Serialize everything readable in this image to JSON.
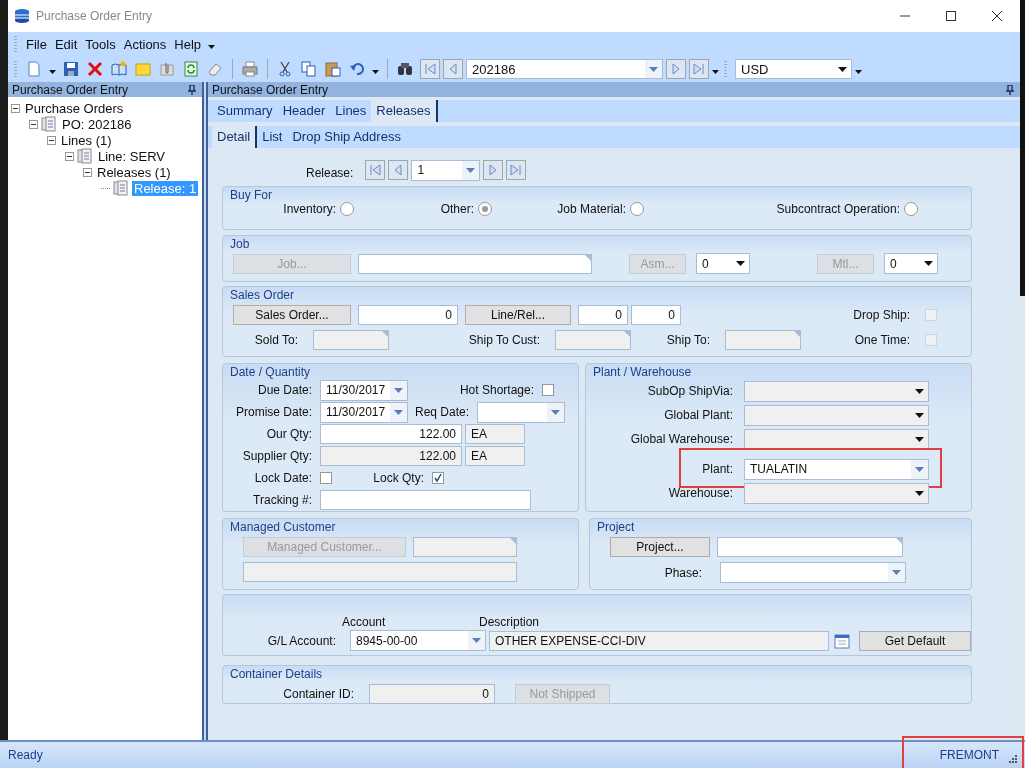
{
  "window": {
    "title": "Purchase Order Entry"
  },
  "menu": [
    {
      "label": "File"
    },
    {
      "label": "Edit"
    },
    {
      "label": "Tools"
    },
    {
      "label": "Actions"
    },
    {
      "label": "Help"
    }
  ],
  "toolbar": {
    "po_number": "202186",
    "currency": "USD"
  },
  "tree_panel": {
    "title": "Purchase Order Entry",
    "items": [
      {
        "label": "Purchase Orders",
        "icon": false,
        "expanded": true,
        "selected": false,
        "children": [
          {
            "label": "PO: 202186",
            "icon": true,
            "expanded": true,
            "selected": false,
            "children": [
              {
                "label": "Lines (1)",
                "icon": false,
                "expanded": true,
                "selected": false,
                "children": [
                  {
                    "label": "Line: SERV",
                    "icon": true,
                    "expanded": true,
                    "selected": false,
                    "children": [
                      {
                        "label": "Releases (1)",
                        "icon": false,
                        "expanded": true,
                        "selected": false,
                        "children": [
                          {
                            "label": "Release: 1",
                            "icon": true,
                            "selected": true
                          }
                        ]
                      }
                    ]
                  }
                ]
              }
            ]
          }
        ]
      }
    ]
  },
  "form_panel": {
    "title": "Purchase Order Entry",
    "tabs": [
      {
        "label": "Summary",
        "selected": false
      },
      {
        "label": "Header",
        "selected": false
      },
      {
        "label": "Lines",
        "selected": false
      },
      {
        "label": "Releases",
        "selected": true
      }
    ],
    "subtabs": [
      {
        "label": "Detail",
        "selected": true
      },
      {
        "label": "List",
        "selected": false
      },
      {
        "label": "Drop Ship Address",
        "selected": false
      }
    ]
  },
  "release": {
    "label": "Release:",
    "value": "1"
  },
  "buy_for": {
    "title": "Buy For",
    "options": [
      {
        "label": "Inventory:",
        "selected": false
      },
      {
        "label": "Other:",
        "selected": true
      },
      {
        "label": "Job Material:",
        "selected": false
      },
      {
        "label": "Subcontract Operation:",
        "selected": false
      }
    ]
  },
  "job": {
    "title": "Job",
    "job_button": {
      "label": "Job...",
      "disabled": true
    },
    "asm_button": {
      "label": "Asm...",
      "disabled": true
    },
    "asm_value": "0",
    "mtl_button": {
      "label": "Mtl...",
      "disabled": true
    },
    "mtl_value": "0"
  },
  "sales_order": {
    "title": "Sales Order",
    "order_button": {
      "label": "Sales Order...",
      "disabled": false
    },
    "order_value": "0",
    "line_button": {
      "label": "Line/Rel...",
      "disabled": false
    },
    "line_value": "0",
    "release_value": "0",
    "drop_ship": {
      "label": "Drop Ship:",
      "checked": false
    },
    "sold_to_label": "Sold To:",
    "ship_to_cust_label": "Ship To Cust:",
    "ship_to_label": "Ship To:",
    "one_time": {
      "label": "One Time:",
      "checked": false
    }
  },
  "date_quantity": {
    "title": "Date / Quantity",
    "due_date": {
      "label": "Due Date:",
      "value": "11/30/2017"
    },
    "promise_date": {
      "label": "Promise Date:",
      "value": "11/30/2017"
    },
    "hot_shortage": {
      "label": "Hot Shortage:",
      "checked": false
    },
    "req_date": {
      "label": "Req Date:"
    },
    "our_qty": {
      "label": "Our Qty:",
      "value": "122.00",
      "uom": "EA"
    },
    "supplier_qty": {
      "label": "Supplier Qty:",
      "value": "122.00",
      "uom": "EA"
    },
    "lock_date": {
      "label": "Lock Date:",
      "checked": false
    },
    "lock_qty": {
      "label": "Lock Qty:",
      "checked": true
    },
    "tracking": {
      "label": "Tracking #:"
    }
  },
  "plant_warehouse": {
    "title": "Plant / Warehouse",
    "fields": [
      {
        "label": "SubOp ShipVia:",
        "disabled": true,
        "highlighted": false
      },
      {
        "label": "Global Plant:",
        "disabled": true,
        "highlighted": false
      },
      {
        "label": "Global Warehouse:",
        "disabled": true,
        "highlighted": false
      },
      {
        "label": "Plant:",
        "value": "TUALATIN",
        "disabled": false,
        "highlighted": true
      },
      {
        "label": "Warehouse:",
        "disabled": true,
        "highlighted": false
      }
    ]
  },
  "managed_customer": {
    "title": "Managed Customer",
    "button": {
      "label": "Managed Customer...",
      "disabled": true
    }
  },
  "project": {
    "title": "Project",
    "button": {
      "label": "Project...",
      "disabled": false
    },
    "phase_label": "Phase:"
  },
  "gl": {
    "account_header": "Account",
    "description_header": "Description",
    "label": "G/L Account:",
    "account": "8945-00-00",
    "description": "OTHER EXPENSE-CCI-DIV",
    "button": {
      "label": "Get Default",
      "disabled": false
    }
  },
  "container": {
    "title": "Container Details",
    "label": "Container ID:",
    "value": "0",
    "button": {
      "label": "Not Shipped",
      "disabled": true
    }
  },
  "status_bar": {
    "text": "Ready",
    "plant": "FREMONT",
    "plant_highlighted": true
  }
}
